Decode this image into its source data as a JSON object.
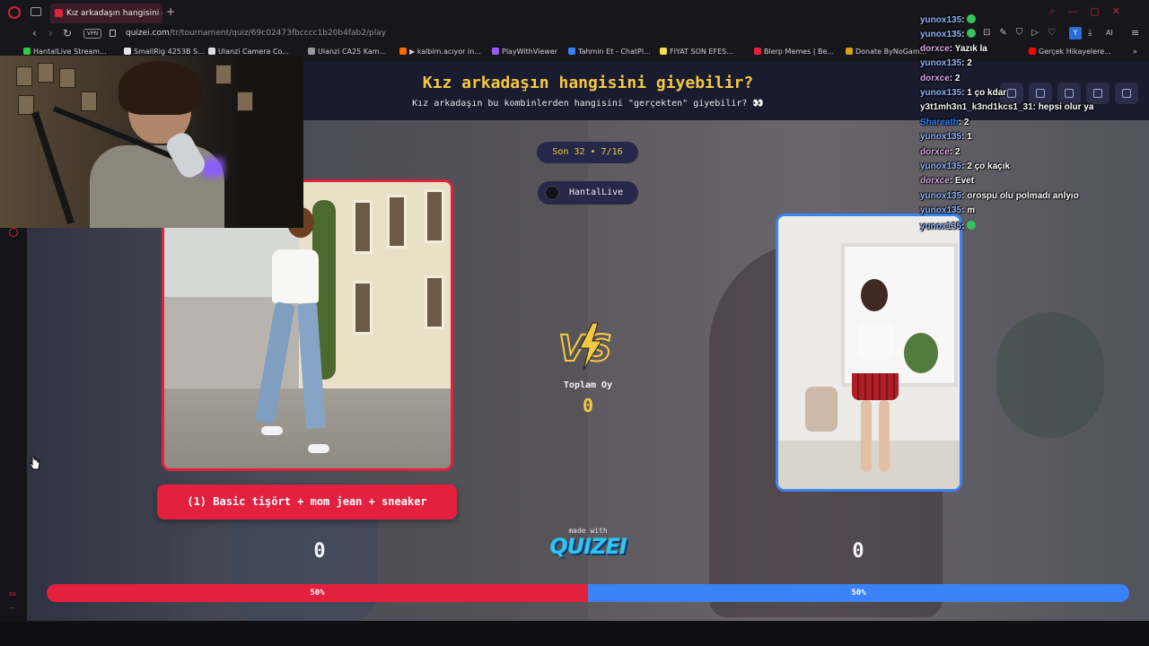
{
  "browser": {
    "tab_title": "Kız arkadaşın hangisini giy",
    "url_domain": "quizei.com",
    "url_path": "/tr/tournament/quiz/69c02473fbcccc1b20b4fab2/play",
    "vpn_label": "VPN",
    "ext_y_label": "Y",
    "ai_label": "AI"
  },
  "bookmarks": [
    {
      "label": "HantalLive Stream...",
      "color": "#2ecc40"
    },
    {
      "label": "SmallRig 4253B S...",
      "color": "#e6e6e6"
    },
    {
      "label": "Ulanzi Camera Co...",
      "color": "#dddddd"
    },
    {
      "label": "Ulanzi CA25 Kam...",
      "color": "#999999"
    },
    {
      "label": "▶ kalbim.acıyor in...",
      "color": "#ff6a00"
    },
    {
      "label": "PlayWithViewer",
      "color": "#9b59ff"
    },
    {
      "label": "Tahmin Et - ChatPl...",
      "color": "#3b82f6"
    },
    {
      "label": "FIYAT SON EFES...",
      "color": "#f5e04a"
    },
    {
      "label": "Blerp Memes | Be...",
      "color": "#e3213e"
    },
    {
      "label": "Donate ByNoGam...",
      "color": "#d4a017"
    },
    {
      "label": "Gerçek Hikayelere...",
      "color": "#ff0000"
    }
  ],
  "quiz": {
    "title": "Kız arkadaşın hangisini giyebilir?",
    "subtitle": "Kız arkadaşın bu kombinlerden hangisini \"gerçekten\" giyebilir? 👀",
    "round": "Son 32 • 7/16",
    "host": "HantalLive",
    "left_option_label": "(1) Basic tişört + mom jean + sneaker",
    "total_votes_label": "Toplam Oy",
    "total_votes": "0",
    "left_score": "0",
    "right_score": "0",
    "left_pct_label": "50%",
    "right_pct_label": "50%",
    "left_share": 0.5,
    "made_with": "made with",
    "brand": "QUIZEI"
  },
  "colors": {
    "accent_red": "#e3213e",
    "accent_blue": "#3b82f6",
    "title_yellow": "#f5c842",
    "header_bg": "#191b2e"
  },
  "chat": [
    {
      "user": "yunox135",
      "color": "#8fb4ff",
      "msg": "",
      "emote": true
    },
    {
      "user": "yunox135",
      "color": "#8fb4ff",
      "msg": "",
      "emote": true
    },
    {
      "user": "dorxce",
      "color": "#d9a7e8",
      "msg": "Yazık la",
      "emote": false
    },
    {
      "user": "yunox135",
      "color": "#8fb4ff",
      "msg": "2",
      "emote": false
    },
    {
      "user": "dorxce",
      "color": "#d9a7e8",
      "msg": "2",
      "emote": false
    },
    {
      "user": "yunox135",
      "color": "#8fb4ff",
      "msg": "1 ço kdar",
      "emote": false
    },
    {
      "user": "y3t1mh3n1_k3nd1kcs1_31",
      "color": "#f2f2f2",
      "msg": "hepsi olur ya",
      "emote": false
    },
    {
      "user": "Shareath",
      "color": "#2a7fff",
      "msg": "2",
      "emote": false
    },
    {
      "user": "yunox135",
      "color": "#8fb4ff",
      "msg": "1",
      "emote": false
    },
    {
      "user": "dorxce",
      "color": "#d9a7e8",
      "msg": "2",
      "emote": false
    },
    {
      "user": "yunox135",
      "color": "#8fb4ff",
      "msg": "2 ço kaçık",
      "emote": false
    },
    {
      "user": "dorxce",
      "color": "#d9a7e8",
      "msg": "Evet",
      "emote": false
    },
    {
      "user": "yunox135",
      "color": "#8fb4ff",
      "msg": "orospu olu polmadı anlyıo",
      "emote": false
    },
    {
      "user": "yunox135",
      "color": "#8fb4ff",
      "msg": "m",
      "emote": false
    },
    {
      "user": "yunox135",
      "color": "#8fb4ff",
      "msg": "",
      "emote": true
    }
  ],
  "sidebar": {
    "bottom_label": "ox"
  }
}
